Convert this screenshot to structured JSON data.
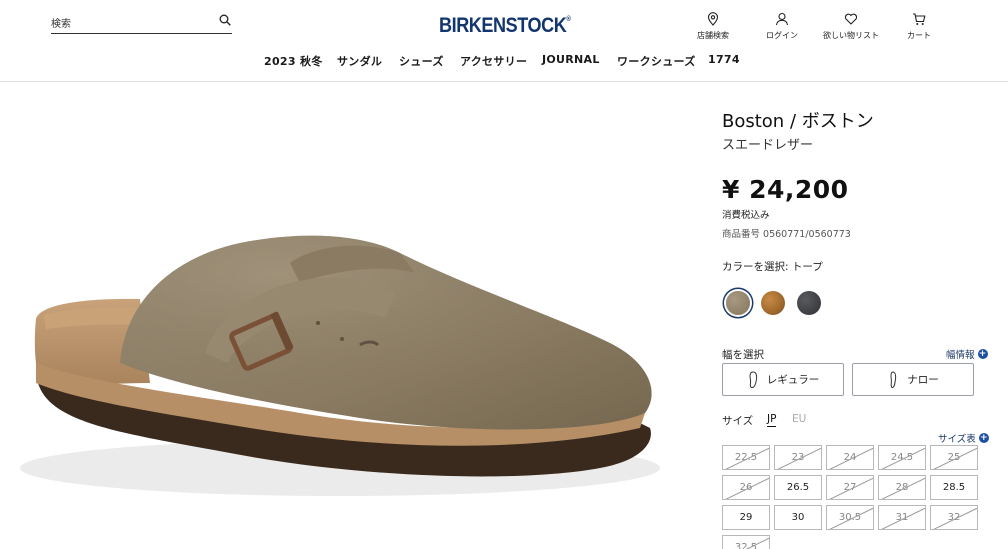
{
  "header": {
    "search_placeholder": "検索",
    "logo_text": "BIRKENSTOCK",
    "logo_mark": "®",
    "utilities": [
      {
        "label": "店舗検索",
        "icon": "location-pin-icon"
      },
      {
        "label": "ログイン",
        "icon": "user-icon"
      },
      {
        "label": "欲しい物リスト",
        "icon": "heart-icon"
      },
      {
        "label": "カート",
        "icon": "cart-icon"
      }
    ],
    "nav": [
      "2023 秋冬",
      "サンダル",
      "シューズ",
      "アクセサリー",
      "JOURNAL",
      "ワークシューズ",
      "1774"
    ]
  },
  "product": {
    "title": "Boston / ボストン",
    "subtitle": "スエードレザー",
    "price": "¥ 24,200",
    "tax_note": "消費税込み",
    "sku": "商品番号 0560771/0560773",
    "color_label": "カラーを選択: トープ",
    "colors": [
      {
        "name": "taupe",
        "hex": "#8f8068",
        "selected": true
      },
      {
        "name": "cork-brown",
        "hex": "#a0692c",
        "selected": false
      },
      {
        "name": "graphite",
        "hex": "#3c3d40",
        "selected": false
      }
    ],
    "width_label": "幅を選択",
    "width_info": "幅情報",
    "widths": [
      "レギュラー",
      "ナロー"
    ],
    "size_label": "サイズ",
    "size_systems": {
      "jp": "JP",
      "eu": "EU"
    },
    "size_chart": "サイズ表",
    "sizes": [
      {
        "label": "22.5",
        "available": false
      },
      {
        "label": "23",
        "available": false
      },
      {
        "label": "24",
        "available": false
      },
      {
        "label": "24.5",
        "available": false
      },
      {
        "label": "25",
        "available": false
      },
      {
        "label": "26",
        "available": false
      },
      {
        "label": "26.5",
        "available": true
      },
      {
        "label": "27",
        "available": false
      },
      {
        "label": "28",
        "available": false
      },
      {
        "label": "28.5",
        "available": true
      },
      {
        "label": "29",
        "available": true
      },
      {
        "label": "30",
        "available": true
      },
      {
        "label": "30.5",
        "available": false
      },
      {
        "label": "31",
        "available": false
      },
      {
        "label": "32",
        "available": false
      },
      {
        "label": "32.5",
        "available": false
      }
    ]
  },
  "colors": {
    "brand_navy": "#12356e",
    "accent_blue": "#1d4fa5"
  }
}
